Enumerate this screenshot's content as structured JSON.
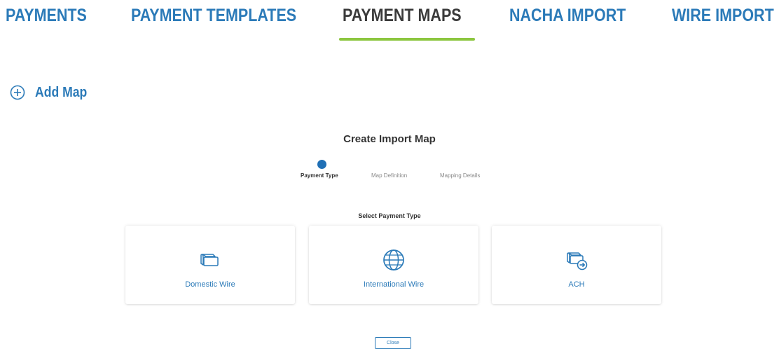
{
  "tabs": [
    {
      "label": "PAYMENTS",
      "active": false
    },
    {
      "label": "PAYMENT TEMPLATES",
      "active": false
    },
    {
      "label": "PAYMENT MAPS",
      "active": true
    },
    {
      "label": "NACHA IMPORT",
      "active": false
    },
    {
      "label": "WIRE IMPORT",
      "active": false
    }
  ],
  "add_map": {
    "label": "Add Map",
    "icon": "plus-circle-icon"
  },
  "dialog": {
    "title": "Create Import Map",
    "steps": [
      {
        "label": "Payment Type",
        "current": true
      },
      {
        "label": "Map Definition",
        "current": false
      },
      {
        "label": "Mapping Details",
        "current": false
      }
    ],
    "select_label": "Select Payment Type",
    "options": [
      {
        "label": "Domestic Wire",
        "icon": "money-bills-icon"
      },
      {
        "label": "International Wire",
        "icon": "globe-icon"
      },
      {
        "label": "ACH",
        "icon": "money-bills-transfer-icon"
      }
    ],
    "close_label": "Close"
  },
  "colors": {
    "accent_blue": "#2b7ab8",
    "active_underline": "#8cc63f",
    "step_dot": "#1f6fb5",
    "active_tab_text": "#3a3a3a"
  }
}
